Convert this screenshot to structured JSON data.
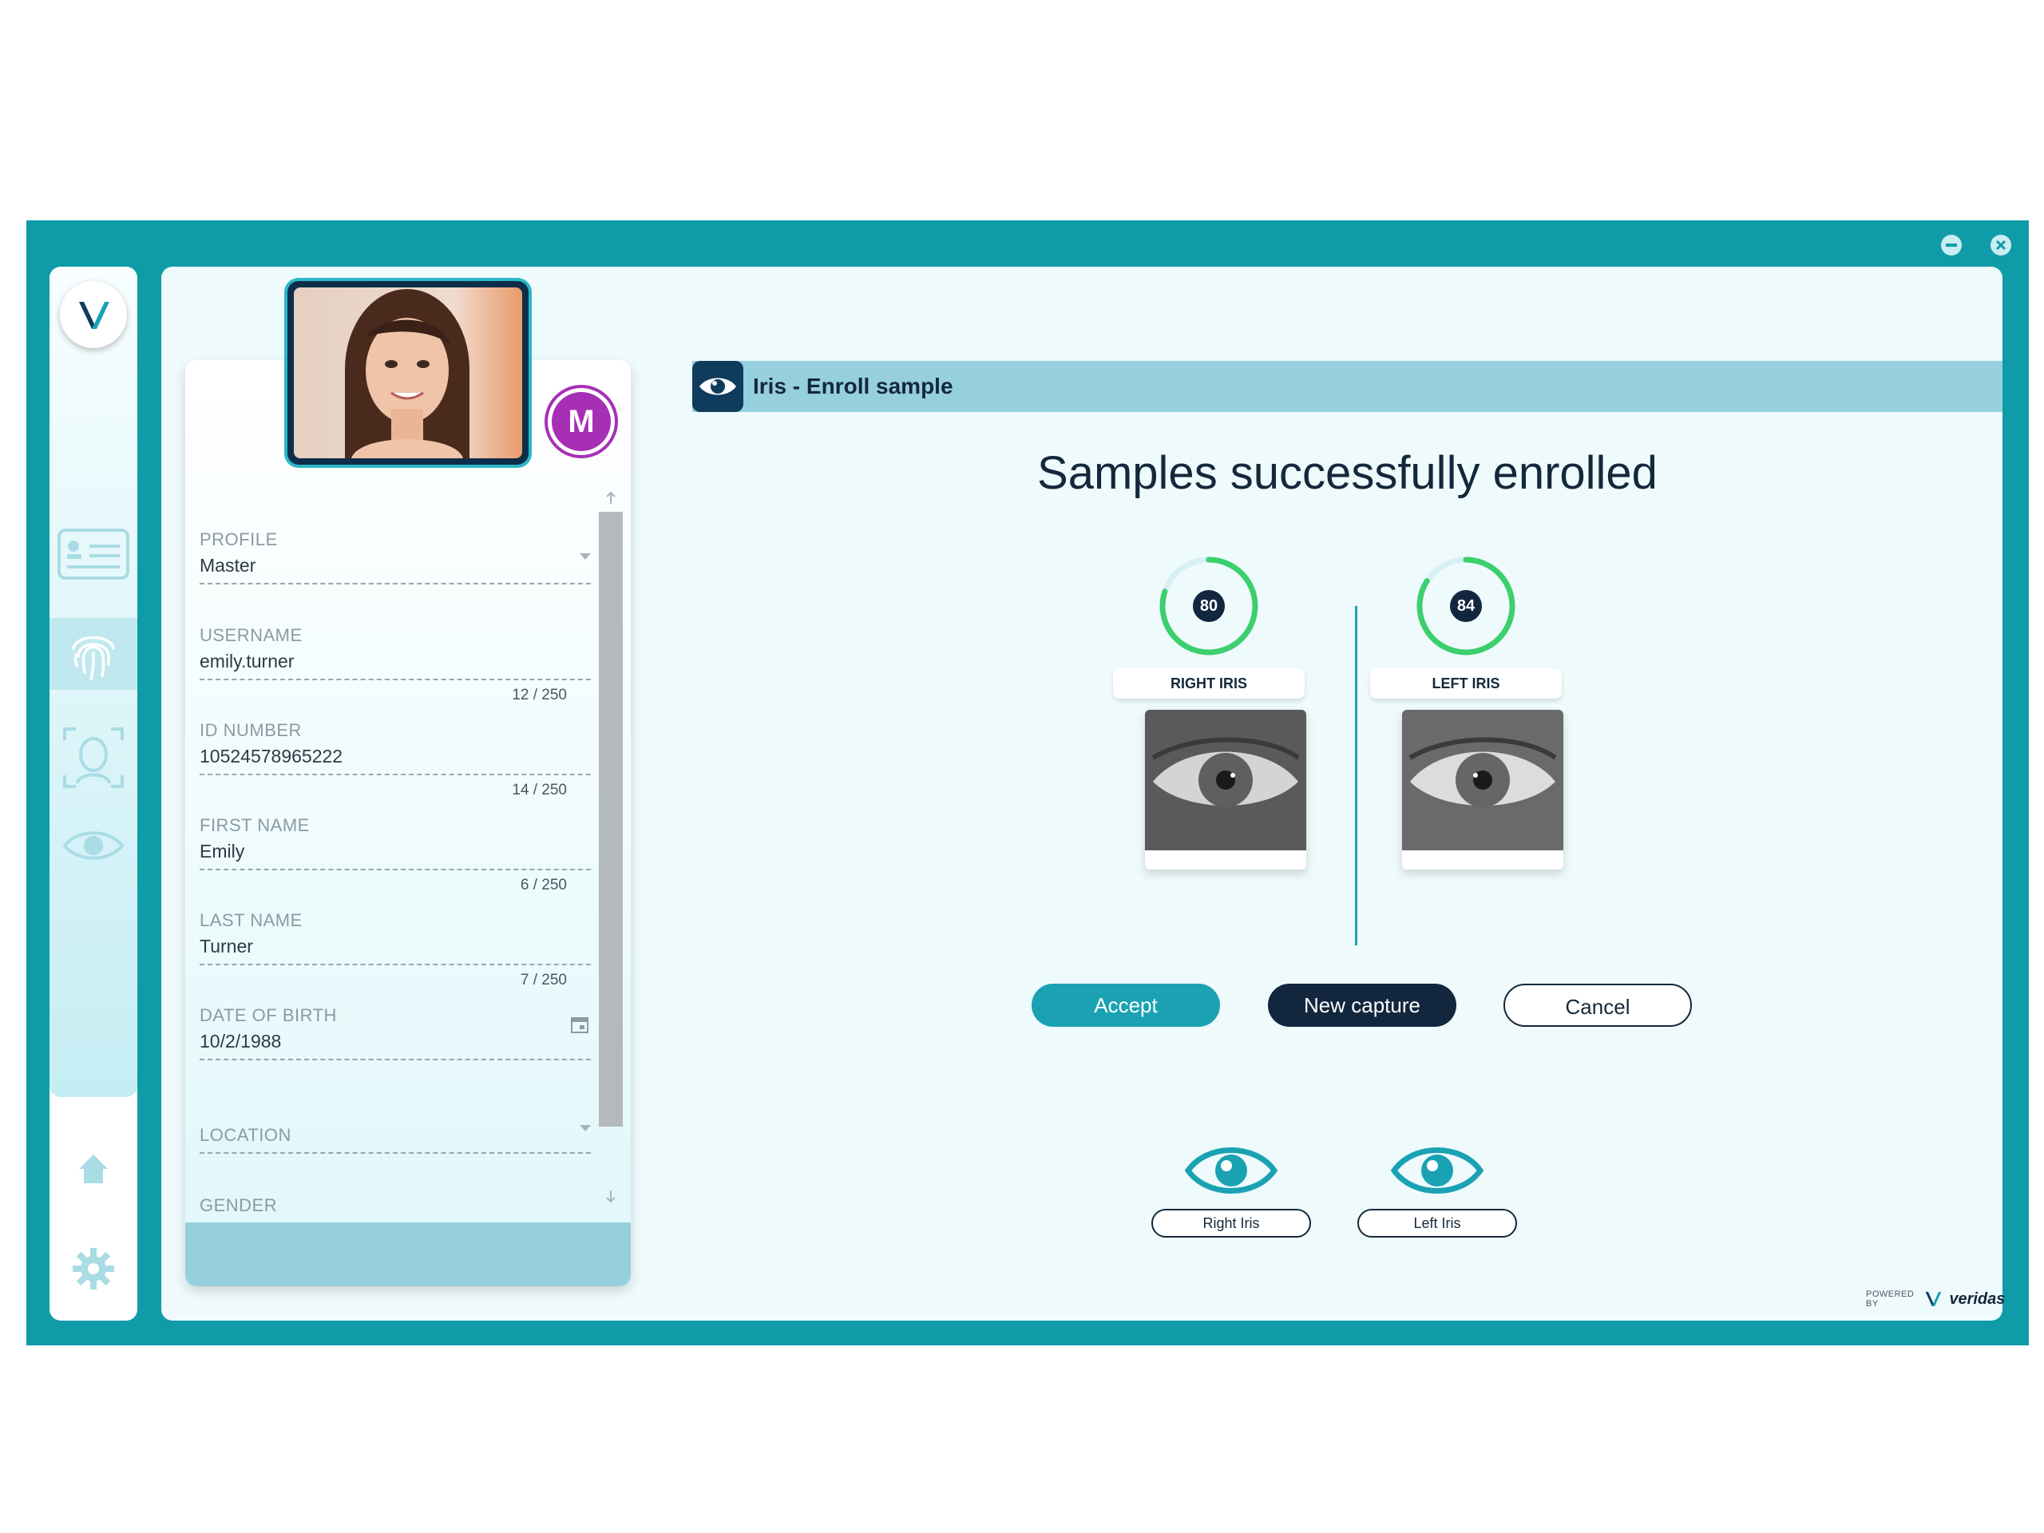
{
  "window": {
    "controls": [
      "minimize-icon",
      "close-icon"
    ]
  },
  "sidebar": {
    "logo": "V",
    "items": [
      {
        "name": "id-card-icon",
        "active": false
      },
      {
        "name": "fingerprint-icon",
        "active": true
      },
      {
        "name": "face-scan-icon",
        "active": false
      },
      {
        "name": "eye-icon",
        "active": false
      }
    ],
    "bottom": [
      {
        "name": "home-icon"
      },
      {
        "name": "gear-icon"
      }
    ]
  },
  "profile": {
    "badge": "M",
    "fields": {
      "profile": {
        "label": "PROFILE",
        "value": "Master"
      },
      "username": {
        "label": "USERNAME",
        "value": "emily.turner",
        "count": "12 / 250"
      },
      "id_number": {
        "label": "ID NUMBER",
        "value": "10524578965222",
        "count": "14 / 250"
      },
      "first_name": {
        "label": "FIRST NAME",
        "value": "Emily",
        "count": "6 / 250"
      },
      "last_name": {
        "label": "LAST NAME",
        "value": "Turner",
        "count": "7 / 250"
      },
      "dob": {
        "label": "DATE OF BIRTH",
        "value": "10/2/1988"
      },
      "location": {
        "label": "LOCATION",
        "value": ""
      },
      "gender": {
        "label": "GENDER"
      }
    }
  },
  "header": {
    "title": "Iris - Enroll sample"
  },
  "main": {
    "title": "Samples successfully enrolled",
    "right_iris": {
      "label": "RIGHT IRIS",
      "score": "80",
      "score_fraction": 0.8
    },
    "left_iris": {
      "label": "LEFT IRIS",
      "score": "84",
      "score_fraction": 0.84
    },
    "buttons": {
      "accept": "Accept",
      "new_capture": "New capture",
      "cancel": "Cancel"
    },
    "selectors": {
      "right": "Right Iris",
      "left": "Left Iris"
    }
  },
  "footer": {
    "powered_by": "POWERED BY",
    "brand": "veridas"
  },
  "colors": {
    "teal": "#0f9ca8",
    "navy": "#12263d",
    "accent": "#1aa2b3",
    "ring_green": "#3ccf6e",
    "badge_purple": "#a72fb6"
  }
}
